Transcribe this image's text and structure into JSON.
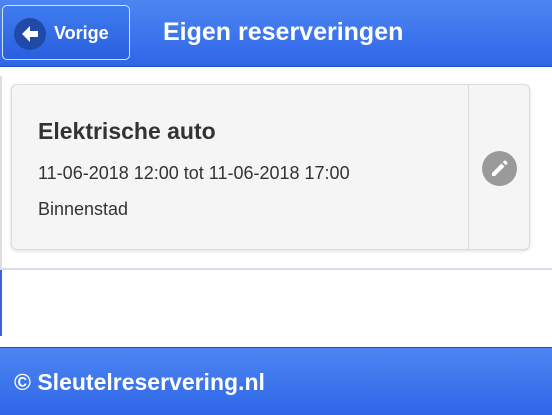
{
  "header": {
    "back_label": "Vorige",
    "title": "Eigen reserveringen"
  },
  "reservations": [
    {
      "title": "Elektrische auto",
      "period": "11-06-2018 12:00 tot 11-06-2018 17:00",
      "location": "Binnenstad",
      "action_icon": "pencil-icon"
    }
  ],
  "footer": {
    "text": "© Sleutelreservering.nl"
  },
  "colors": {
    "bar": "#3a74ec",
    "card_background": "#f5f5f5",
    "edit_icon": "#9a9a9a"
  }
}
